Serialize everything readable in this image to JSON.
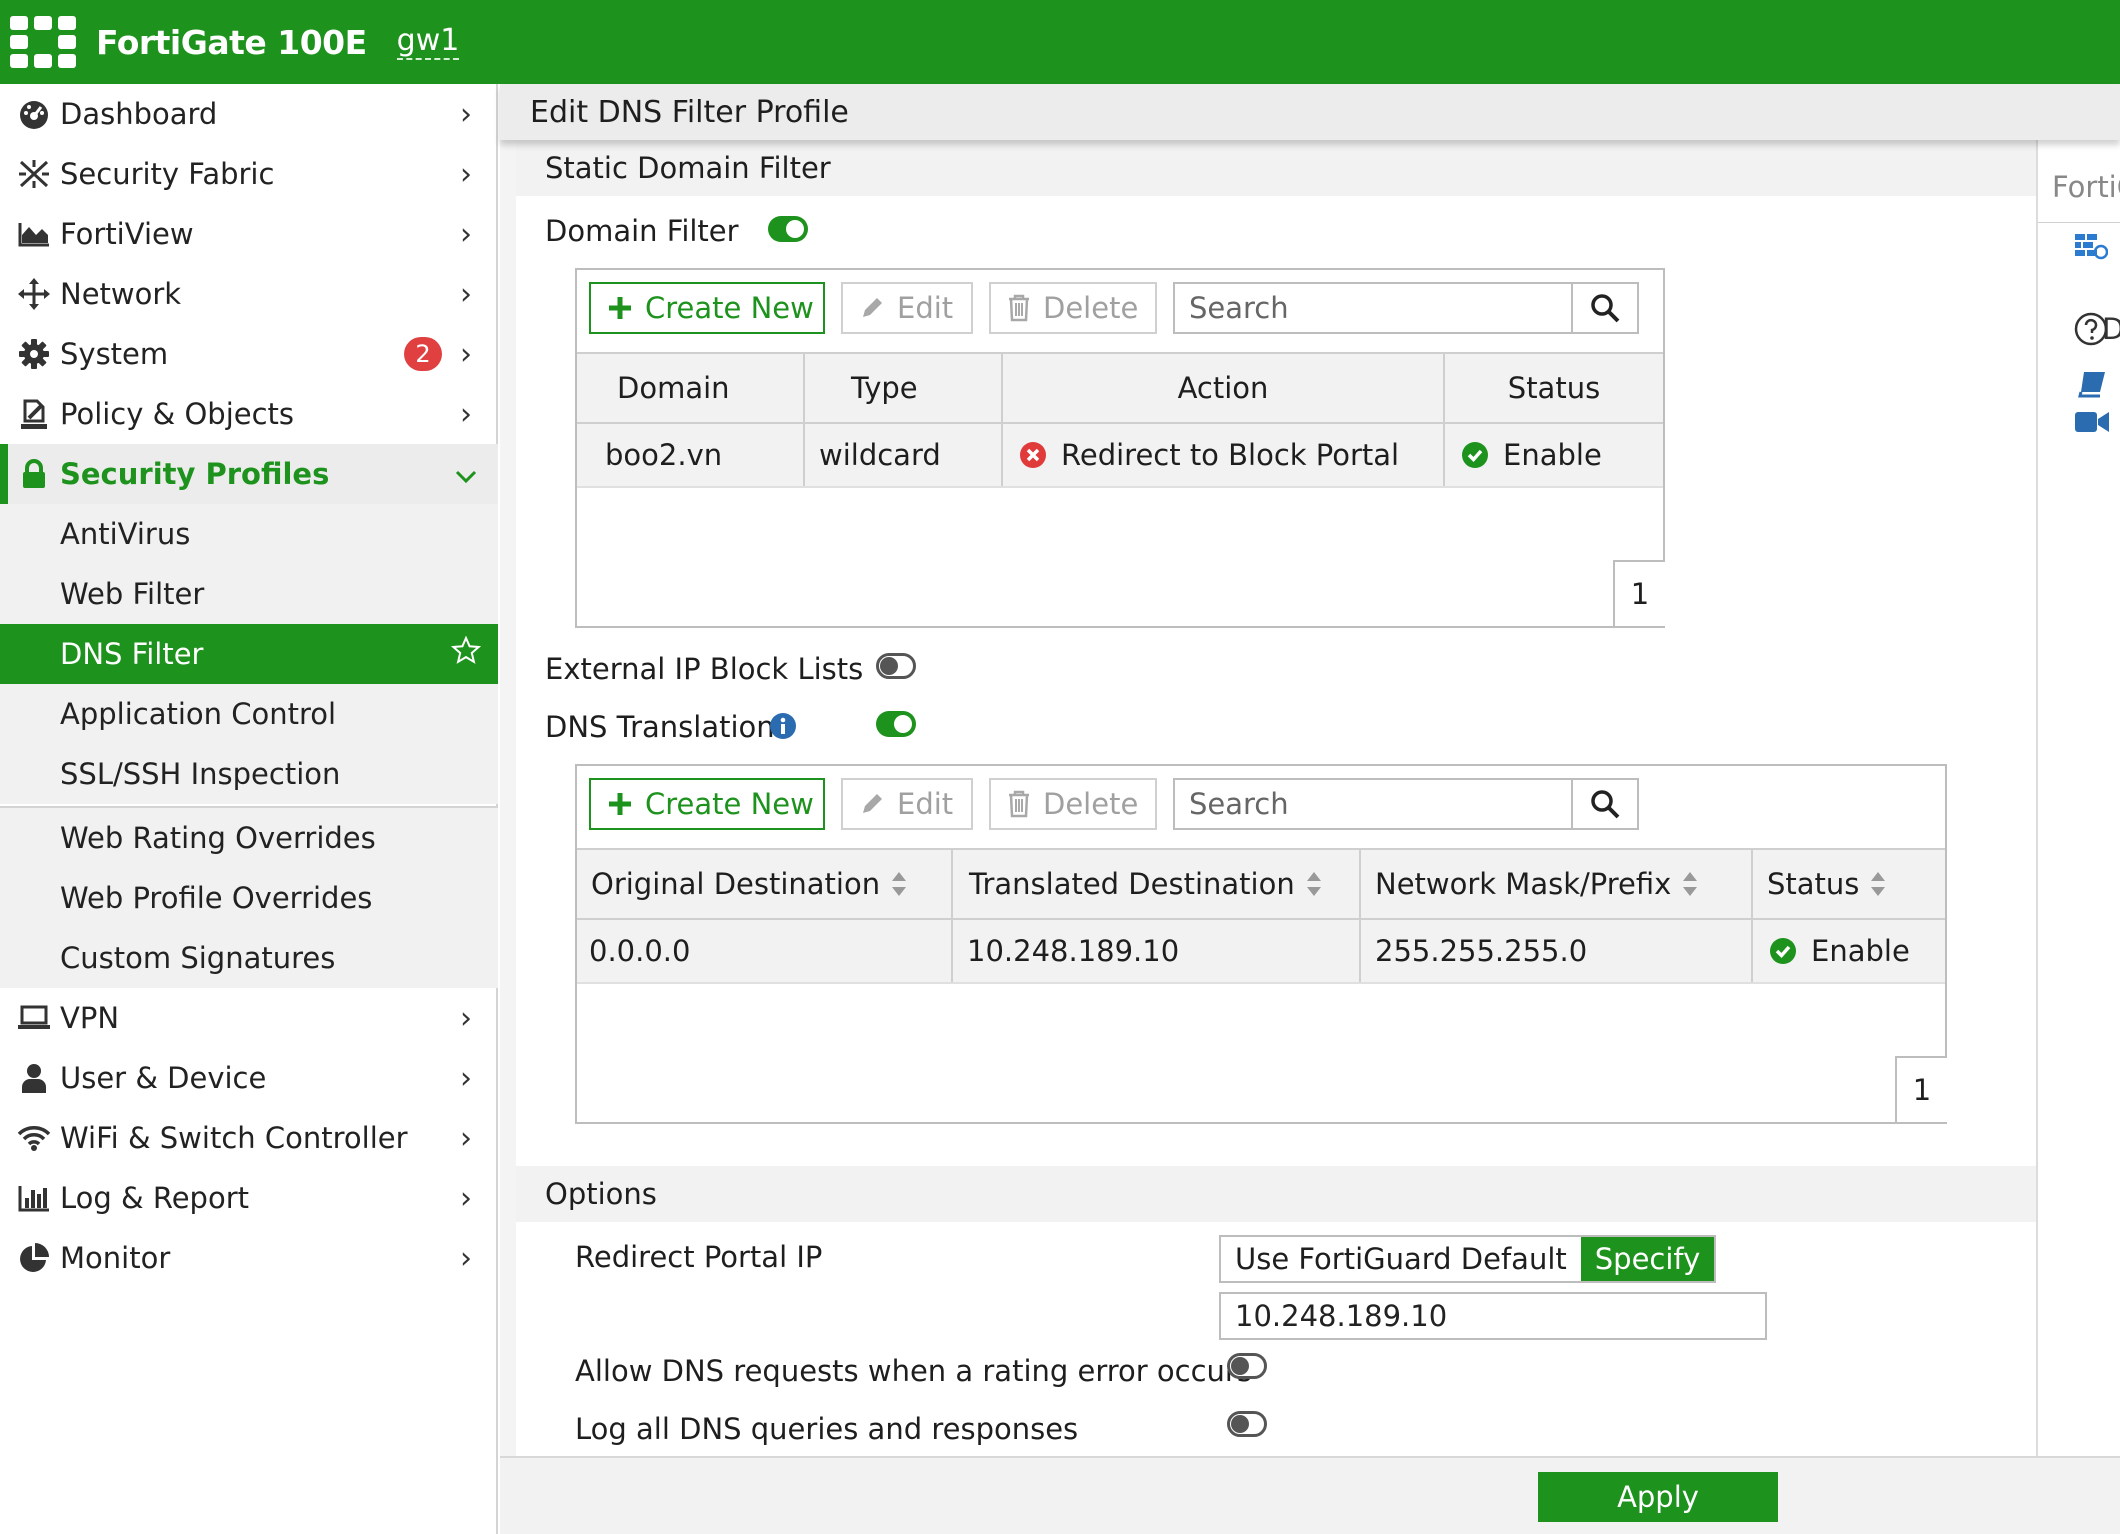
{
  "app": {
    "model": "FortiGate 100E",
    "hostname": "gw1",
    "brand_color": "#1d921d"
  },
  "sidebar": {
    "items": [
      {
        "label": "Dashboard",
        "icon": "dashboard-icon"
      },
      {
        "label": "Security Fabric",
        "icon": "security-fabric-icon"
      },
      {
        "label": "FortiView",
        "icon": "fortiview-icon"
      },
      {
        "label": "Network",
        "icon": "network-icon"
      },
      {
        "label": "System",
        "icon": "gear-icon",
        "badge": "2"
      },
      {
        "label": "Policy & Objects",
        "icon": "policy-icon"
      },
      {
        "label": "Security Profiles",
        "icon": "lock-icon"
      },
      {
        "label": "VPN",
        "icon": "laptop-icon"
      },
      {
        "label": "User & Device",
        "icon": "user-icon"
      },
      {
        "label": "WiFi & Switch Controller",
        "icon": "wifi-icon"
      },
      {
        "label": "Log & Report",
        "icon": "bar-chart-icon"
      },
      {
        "label": "Monitor",
        "icon": "pie-chart-icon"
      }
    ],
    "subitems": [
      {
        "label": "AntiVirus"
      },
      {
        "label": "Web Filter"
      },
      {
        "label": "DNS Filter"
      },
      {
        "label": "Application Control"
      },
      {
        "label": "SSL/SSH Inspection"
      },
      {
        "label": "Web Rating Overrides"
      },
      {
        "label": "Web Profile Overrides"
      },
      {
        "label": "Custom Signatures"
      }
    ]
  },
  "page": {
    "title": "Edit DNS Filter Profile",
    "static_domain_filter": {
      "heading": "Static Domain Filter",
      "toggle_label": "Domain Filter",
      "toggle_on": true,
      "toolbar": {
        "create": "Create New",
        "edit": "Edit",
        "delete": "Delete",
        "search_placeholder": "Search"
      },
      "columns": [
        "Domain",
        "Type",
        "Action",
        "Status"
      ],
      "rows": [
        {
          "domain": "boo2.vn",
          "type": "wildcard",
          "action": "Redirect to Block Portal",
          "status": "Enable"
        }
      ],
      "page": "1"
    },
    "external_ip_block_lists": {
      "label": "External IP Block Lists",
      "toggle_on": false
    },
    "dns_translation": {
      "label": "DNS Translation",
      "toggle_on": true,
      "toolbar": {
        "create": "Create New",
        "edit": "Edit",
        "delete": "Delete",
        "search_placeholder": "Search"
      },
      "columns": [
        "Original Destination",
        "Translated Destination",
        "Network Mask/Prefix",
        "Status"
      ],
      "rows": [
        {
          "original": "0.0.0.0",
          "translated": "10.248.189.10",
          "mask": "255.255.255.0",
          "status": "Enable"
        }
      ],
      "page": "1"
    },
    "options": {
      "heading": "Options",
      "redirect_portal_label": "Redirect Portal IP",
      "redirect_options": [
        "Use FortiGuard Default",
        "Specify"
      ],
      "redirect_selected": "Specify",
      "redirect_ip": "10.248.189.10",
      "allow_dns_label": "Allow DNS requests when a rating error occurs",
      "allow_dns_on": false,
      "log_all_label": "Log all DNS queries and responses",
      "log_all_on": false
    },
    "apply_label": "Apply"
  },
  "right_panel": {
    "title": "FortiG",
    "partial_label": "D"
  }
}
